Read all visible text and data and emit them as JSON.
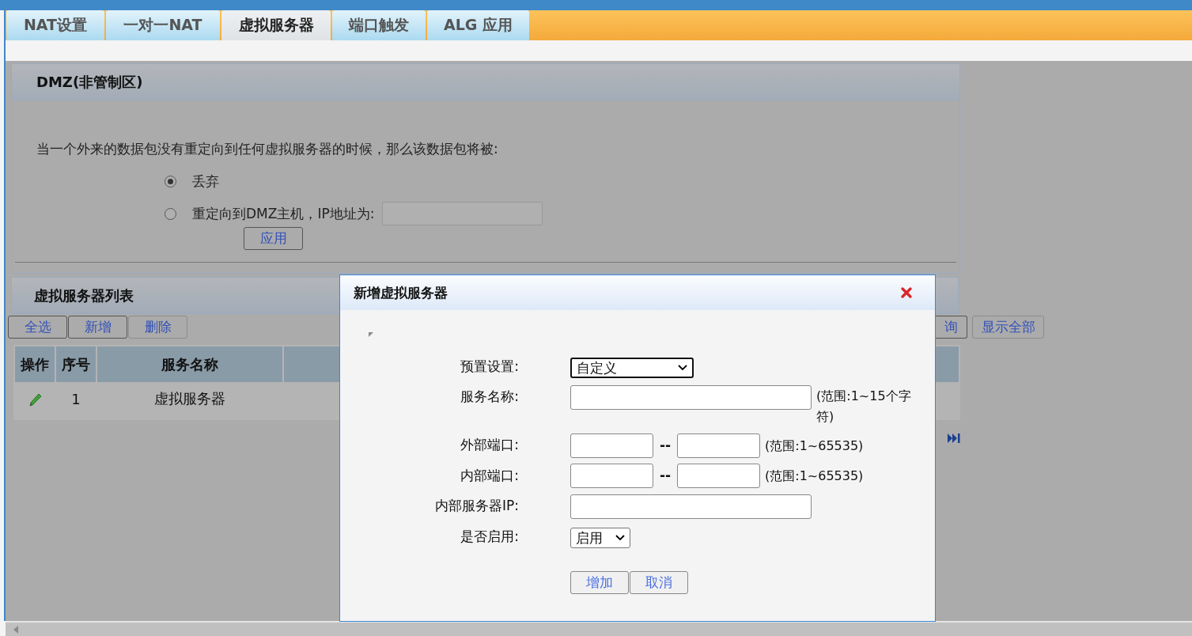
{
  "tabs": [
    {
      "label": "NAT设置",
      "selected": false
    },
    {
      "label": "一对一NAT",
      "selected": false
    },
    {
      "label": "虚拟服务器",
      "selected": true
    },
    {
      "label": "端口触发",
      "selected": false
    },
    {
      "label": "ALG 应用",
      "selected": false
    }
  ],
  "dmz": {
    "title": "DMZ(非管制区)",
    "description": "当一个外来的数据包没有重定向到任何虚拟服务器的时候，那么该数据包将被:",
    "options": [
      {
        "label": "丢弃",
        "selected": true,
        "has_field": false
      },
      {
        "label": "重定向到DMZ主机，IP地址为:",
        "selected": false,
        "has_field": true
      }
    ],
    "apply_button": "应用"
  },
  "server_list": {
    "title": "虚拟服务器列表",
    "buttons": [
      {
        "label": "全选",
        "disabled": false
      },
      {
        "label": "新增",
        "disabled": false
      },
      {
        "label": "删除",
        "disabled": true
      }
    ],
    "right_buttons": [
      {
        "label": "询",
        "disabled": false
      },
      {
        "label": "显示全部",
        "disabled": true
      }
    ],
    "table": {
      "columns": [
        "操作",
        "序号",
        "服务名称"
      ],
      "rows": [
        {
          "index": "1",
          "name": "虚拟服务器"
        }
      ]
    }
  },
  "dialog": {
    "title": "新增虚拟服务器",
    "fields": [
      {
        "kind": "select",
        "label": "预置设置:",
        "value": "自定义",
        "focused": true
      },
      {
        "kind": "text",
        "label": "服务名称:",
        "hint": "(范围:1~15个字符)"
      },
      {
        "kind": "range",
        "label": "外部端口:",
        "separator": "--",
        "hint": "(范围:1~65535)"
      },
      {
        "kind": "range",
        "label": "内部端口:",
        "separator": "--",
        "hint": "(范围:1~65535)"
      },
      {
        "kind": "text",
        "label": "内部服务器IP:"
      },
      {
        "kind": "select",
        "label": "是否启用:",
        "value": "启用",
        "focused": false
      }
    ],
    "buttons": [
      "增加",
      "取消"
    ]
  }
}
